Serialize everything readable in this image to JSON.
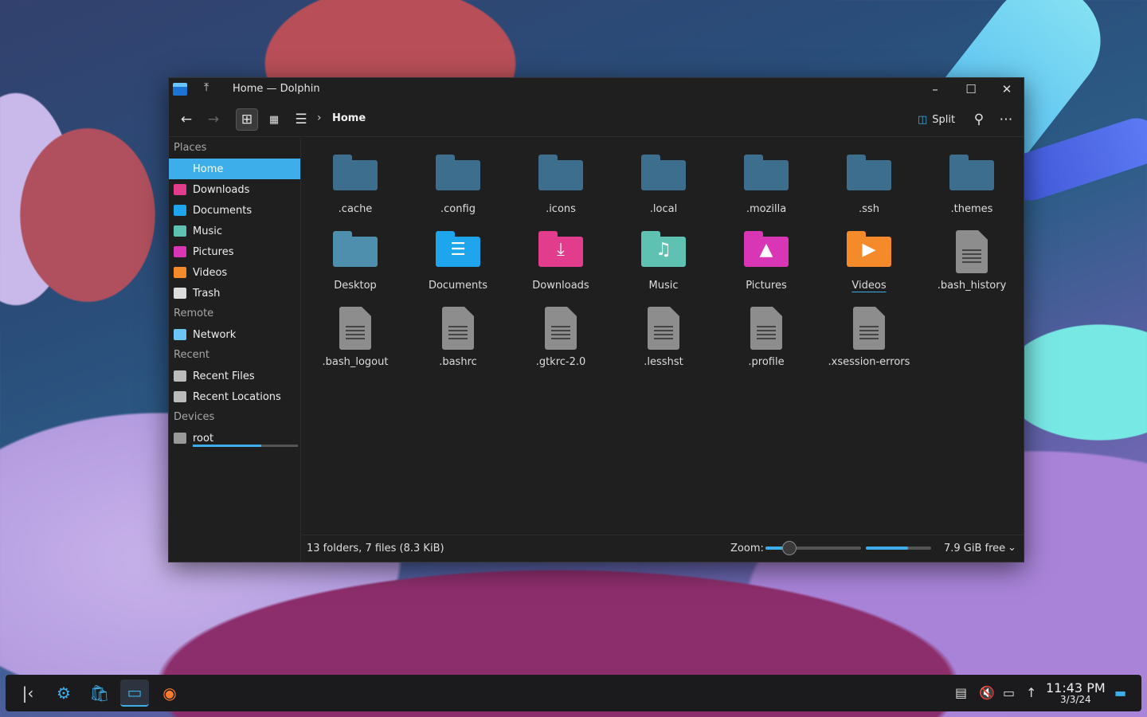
{
  "window": {
    "title": "Home — Dolphin",
    "minimize": "–",
    "maximize": "☐",
    "close": "✕"
  },
  "toolbar": {
    "breadcrumb": "Home",
    "split_label": "Split"
  },
  "sidebar": {
    "sections": [
      {
        "title": "Places",
        "items": [
          {
            "label": "Home",
            "icon": "home-icon",
            "selected": true
          },
          {
            "label": "Downloads",
            "icon": "downloads-icon"
          },
          {
            "label": "Documents",
            "icon": "documents-icon"
          },
          {
            "label": "Music",
            "icon": "music-icon"
          },
          {
            "label": "Pictures",
            "icon": "pictures-icon"
          },
          {
            "label": "Videos",
            "icon": "videos-icon"
          },
          {
            "label": "Trash",
            "icon": "trash-icon"
          }
        ]
      },
      {
        "title": "Remote",
        "items": [
          {
            "label": "Network",
            "icon": "network-icon"
          }
        ]
      },
      {
        "title": "Recent",
        "items": [
          {
            "label": "Recent Files",
            "icon": "recent-files-icon"
          },
          {
            "label": "Recent Locations",
            "icon": "recent-locations-icon"
          }
        ]
      },
      {
        "title": "Devices",
        "items": [
          {
            "label": "root",
            "icon": "drive-icon",
            "usage": 0.65
          }
        ]
      }
    ]
  },
  "files": [
    {
      "name": ".cache",
      "kind": "folder",
      "color": "#3d6e8e"
    },
    {
      "name": ".config",
      "kind": "folder",
      "color": "#3d6e8e"
    },
    {
      "name": ".icons",
      "kind": "folder",
      "color": "#3d6e8e"
    },
    {
      "name": ".local",
      "kind": "folder",
      "color": "#3d6e8e"
    },
    {
      "name": ".mozilla",
      "kind": "folder",
      "color": "#3d6e8e"
    },
    {
      "name": ".ssh",
      "kind": "folder",
      "color": "#3d6e8e"
    },
    {
      "name": ".themes",
      "kind": "folder",
      "color": "#3d6e8e"
    },
    {
      "name": "Desktop",
      "kind": "folder",
      "color": "#4f8fae"
    },
    {
      "name": "Documents",
      "kind": "folder",
      "color": "#1fa5ec",
      "glyph": "☰"
    },
    {
      "name": "Downloads",
      "kind": "folder",
      "color": "#e23d8c",
      "glyph": "⤓"
    },
    {
      "name": "Music",
      "kind": "folder",
      "color": "#5fc1b2",
      "glyph": "♫"
    },
    {
      "name": "Pictures",
      "kind": "folder",
      "color": "#d936b5",
      "glyph": "▲"
    },
    {
      "name": "Videos",
      "kind": "folder",
      "color": "#f58a2a",
      "glyph": "▶",
      "hovered": true
    },
    {
      "name": ".bash_history",
      "kind": "file"
    },
    {
      "name": ".bash_logout",
      "kind": "file"
    },
    {
      "name": ".bashrc",
      "kind": "file"
    },
    {
      "name": ".gtkrc-2.0",
      "kind": "file"
    },
    {
      "name": ".lesshst",
      "kind": "file"
    },
    {
      "name": ".profile",
      "kind": "file"
    },
    {
      "name": ".xsession-errors",
      "kind": "file"
    }
  ],
  "status": {
    "summary": "13 folders, 7 files (8.3 KiB)",
    "zoom_label": "Zoom:",
    "zoom_level": 0.25,
    "free_fraction": 0.65,
    "free_label": "7.9 GiB free"
  },
  "taskbar": {
    "time": "11:43 PM",
    "date": "3/3/24"
  },
  "colors": {
    "accent": "#3daee9",
    "window_bg": "#1f1f1f"
  }
}
